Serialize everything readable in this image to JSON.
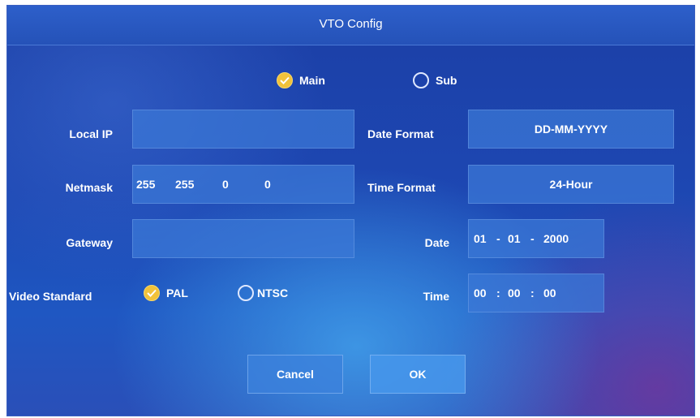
{
  "title": "VTO Config",
  "mode": {
    "main_label": "Main",
    "sub_label": "Sub",
    "selected": "Main"
  },
  "local_ip": {
    "label": "Local IP",
    "value": ""
  },
  "netmask": {
    "label": "Netmask",
    "octets": [
      "255",
      "255",
      "0",
      "0"
    ]
  },
  "gateway": {
    "label": "Gateway",
    "value": ""
  },
  "video_standard": {
    "label": "Video Standard",
    "pal_label": "PAL",
    "ntsc_label": "NTSC",
    "selected": "PAL"
  },
  "date_format": {
    "label": "Date Format",
    "value": "DD-MM-YYYY"
  },
  "time_format": {
    "label": "Time Format",
    "value": "24-Hour"
  },
  "date": {
    "label": "Date",
    "day": "01",
    "month": "01",
    "year": "2000",
    "sep": "-"
  },
  "time": {
    "label": "Time",
    "hour": "00",
    "minute": "00",
    "second": "00",
    "sep": ":"
  },
  "buttons": {
    "cancel": "Cancel",
    "ok": "OK"
  },
  "colors": {
    "accent_check": "#f2c23a",
    "panel": "#1d47b2",
    "field": "#3c78d7"
  },
  "icons": {
    "checked": "check-circle-icon",
    "unchecked": "radio-empty-icon"
  }
}
